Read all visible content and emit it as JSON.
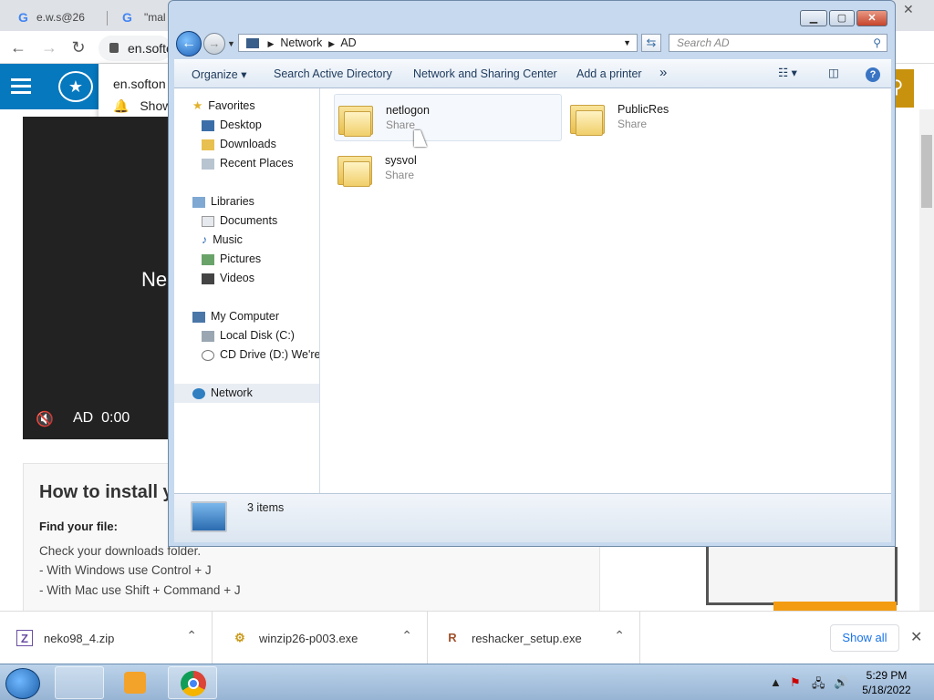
{
  "browser": {
    "tabs": [
      {
        "label": "e.w.s@26"
      },
      {
        "label": "\"mal"
      }
    ],
    "url": "en.softon",
    "close_label": "✕"
  },
  "site": {
    "notification": {
      "title": "en.softon",
      "action": "Show"
    },
    "video": {
      "title_partial": "Ne",
      "ad_label": "AD",
      "time": "0:00"
    },
    "install": {
      "heading": "How to install y",
      "find_heading": "Find your file:",
      "lines": [
        "Check your downloads folder.",
        "- With Windows use Control + J",
        "- With Mac use Shift + Command + J"
      ]
    }
  },
  "downloads": {
    "items": [
      {
        "name": "neko98_4.zip",
        "icon": "zip-icon"
      },
      {
        "name": "winzip26-p003.exe",
        "icon": "exe-icon"
      },
      {
        "name": "reshacker_setup.exe",
        "icon": "reshacker-icon"
      }
    ],
    "show_all": "Show all",
    "close": "✕"
  },
  "explorer": {
    "breadcrumb": [
      "Network",
      "AD"
    ],
    "search_placeholder": "Search AD",
    "commands": [
      "Organize",
      "Search Active Directory",
      "Network and Sharing Center",
      "Add a printer",
      "»"
    ],
    "nav": {
      "favorites": {
        "label": "Favorites",
        "items": [
          "Desktop",
          "Downloads",
          "Recent Places"
        ]
      },
      "libraries": {
        "label": "Libraries",
        "items": [
          "Documents",
          "Music",
          "Pictures",
          "Videos"
        ]
      },
      "computer": {
        "label": "My Computer",
        "items": [
          "Local Disk (C:)",
          "CD Drive (D:) We're g"
        ]
      },
      "network": {
        "label": "Network"
      }
    },
    "items": [
      {
        "name": "netlogon",
        "type": "Share",
        "selected": true
      },
      {
        "name": "PublicRes",
        "type": "Share",
        "selected": false
      },
      {
        "name": "sysvol",
        "type": "Share",
        "selected": false
      }
    ],
    "status": "3 items"
  },
  "taskbar": {
    "time": "5:29 PM",
    "date": "5/18/2022"
  },
  "colors": {
    "site_blue": "#0678be",
    "accent_gold": "#c8920e",
    "taskbar": "#bcd3ea"
  }
}
